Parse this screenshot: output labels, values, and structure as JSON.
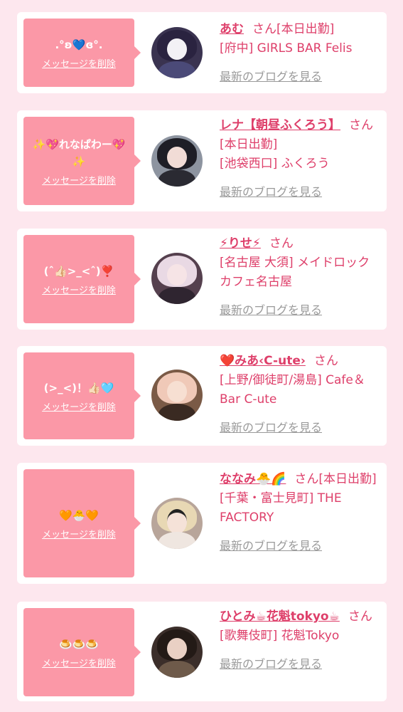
{
  "delete_label": "メッセージを削除",
  "blog_label": "最新のブログを見る",
  "san_label": "さん",
  "cards": [
    {
      "message": ".°ʚ💙ɞ°.",
      "name": "あむ",
      "status": "[本日出勤]",
      "area": "[府中] GIRLS BAR Felis"
    },
    {
      "message": "✨💖れなぱわー💖✨",
      "name": "レナ【朝昼ふくろう】",
      "status": "[本日出勤]",
      "area": "[池袋西口] ふくろう"
    },
    {
      "message": "(ˆ👍🏻>_<ˆ)❣️",
      "name": "⚡りせ⚡",
      "status": "",
      "area": "[名古屋 大須] メイドロックカフェ名古屋"
    },
    {
      "message": "(>_<)！👍🏻🩵",
      "name": "❤️みあ‹C-ute›",
      "status": "",
      "area": "[上野/御徒町/湯島] Cafe＆Bar C-ute"
    },
    {
      "message": "🧡🐣🧡",
      "name": "ななみ🐣🌈",
      "status": "[本日出勤]",
      "area": "[千葉・富士見町] THE FACTORY"
    },
    {
      "message": "🍮🍮🍮",
      "name": "ひとみ☕花魁tokyo☕",
      "status": "",
      "area": "[歌舞伎町] 花魁Tokyo"
    }
  ]
}
